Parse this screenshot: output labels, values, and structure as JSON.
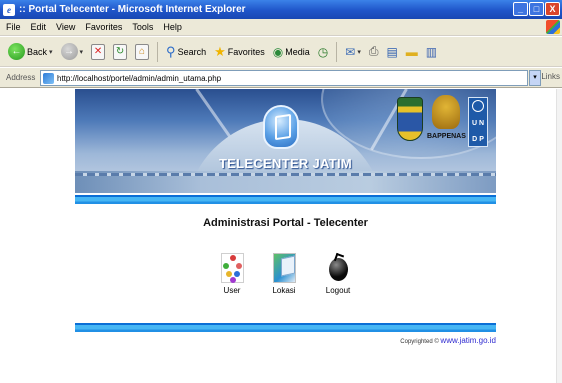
{
  "window": {
    "title": ":: Portal Telecenter - Microsoft Internet Explorer",
    "buttons": [
      "_",
      "□",
      "X"
    ]
  },
  "menubar": [
    "File",
    "Edit",
    "View",
    "Favorites",
    "Tools",
    "Help"
  ],
  "toolbar": {
    "back_label": "Back",
    "search_label": "Search",
    "favorites_label": "Favorites",
    "media_label": "Media"
  },
  "addressbar": {
    "label": "Address",
    "url": "http://localhost/portel/admin/admin_utama.php",
    "links_label": "Links"
  },
  "banner": {
    "title": "TELECENTER JATIM",
    "bappenas_label": "BAPPENAS",
    "undp_letters": [
      "U",
      "N",
      "D",
      "P"
    ]
  },
  "page": {
    "heading": "Administrasi Portal - Telecenter",
    "menu": [
      {
        "label": "User",
        "icon": "users-tree-icon"
      },
      {
        "label": "Lokasi",
        "icon": "location-icon"
      },
      {
        "label": "Logout",
        "icon": "bomb-icon"
      }
    ],
    "footer_prefix": "Copyrighted ©",
    "footer_brand": "www.jatim.go.id"
  },
  "colors": {
    "titlebar": "#1f55c9",
    "chrome": "#ece9d8",
    "banner_bar": "#46b6f4",
    "footer_link": "#2f2bd0"
  }
}
